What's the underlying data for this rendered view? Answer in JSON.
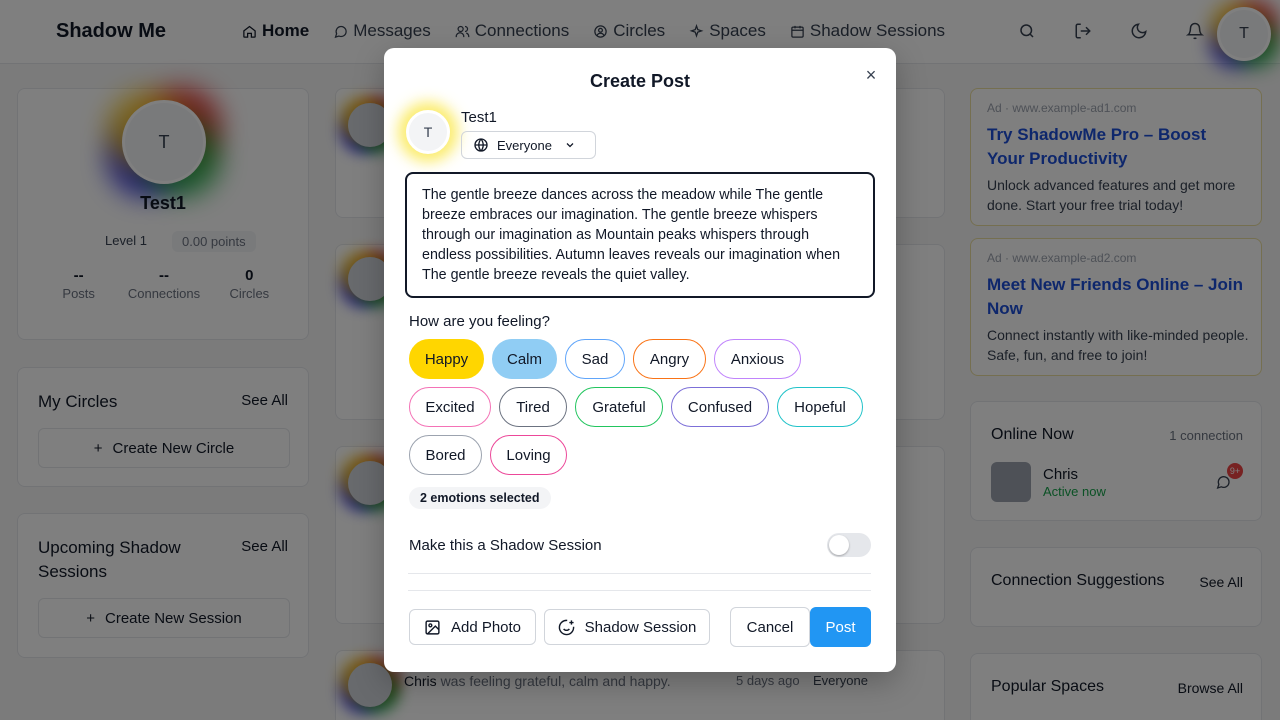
{
  "nav": {
    "brand": "Shadow Me",
    "items": [
      {
        "label": "Home",
        "icon": "home-icon"
      },
      {
        "label": "Messages",
        "icon": "messages-icon"
      },
      {
        "label": "Connections",
        "icon": "users-icon"
      },
      {
        "label": "Circles",
        "icon": "circles-icon"
      },
      {
        "label": "Spaces",
        "icon": "sparkle-icon"
      },
      {
        "label": "Shadow Sessions",
        "icon": "calendar-icon"
      }
    ],
    "avatar_initial": "T"
  },
  "profile": {
    "initial": "T",
    "name": "Test1",
    "level": "Level 1",
    "points": "0.00 points",
    "stats": [
      {
        "value": "--",
        "label": "Posts"
      },
      {
        "value": "--",
        "label": "Connections"
      },
      {
        "value": "0",
        "label": "Circles"
      }
    ]
  },
  "circles": {
    "title": "My Circles",
    "link": "See All",
    "button": "Create New Circle"
  },
  "sessions": {
    "title": "Upcoming Shadow Sessions",
    "link": "See All",
    "button": "Create New Session"
  },
  "feed": {
    "post3": {
      "author": "Chris",
      "action": "was feeling grateful, calm and happy.",
      "time": "5 days ago",
      "audience": "Everyone"
    }
  },
  "ads": [
    {
      "label": "Ad · www.example-ad1.com",
      "title": "Try ShadowMe Pro – Boost Your Productivity",
      "desc": "Unlock advanced features and get more done. Start your free trial today!"
    },
    {
      "label": "Ad · www.example-ad2.com",
      "title": "Meet New Friends Online – Join Now",
      "desc": "Connect instantly with like-minded people. Safe, fun, and free to join!"
    }
  ],
  "online": {
    "title": "Online Now",
    "count": "1 connection",
    "user": "Chris",
    "status": "Active now",
    "badge": "9+"
  },
  "suggestions": {
    "title": "Connection Suggestions",
    "link": "See All"
  },
  "spaces": {
    "title": "Popular Spaces",
    "link": "Browse All"
  },
  "modal": {
    "title": "Create Post",
    "close": "×",
    "initial": "T",
    "user": "Test1",
    "audience": "Everyone",
    "text": "The gentle breeze dances across the meadow while The gentle breeze embraces our imagination. The gentle breeze whispers through our imagination as Mountain peaks whispers through endless possibilities. Autumn leaves reveals our imagination when The gentle breeze reveals the quiet valley.",
    "feeling_label": "How are you feeling?",
    "emotions": [
      {
        "label": "Happy",
        "selected": true,
        "color": "#ffd600"
      },
      {
        "label": "Calm",
        "selected": true,
        "color": "#90cdf4"
      },
      {
        "label": "Sad",
        "selected": false,
        "color": "#60a5fa"
      },
      {
        "label": "Angry",
        "selected": false,
        "color": "#f97316"
      },
      {
        "label": "Anxious",
        "selected": false,
        "color": "#c084fc"
      },
      {
        "label": "Excited",
        "selected": false,
        "color": "#f472b6"
      },
      {
        "label": "Tired",
        "selected": false,
        "color": "#6b7280"
      },
      {
        "label": "Grateful",
        "selected": false,
        "color": "#22c55e"
      },
      {
        "label": "Confused",
        "selected": false,
        "color": "#7c6fd8"
      },
      {
        "label": "Hopeful",
        "selected": false,
        "color": "#22c3c9"
      },
      {
        "label": "Bored",
        "selected": false,
        "color": "#9ca3af"
      },
      {
        "label": "Loving",
        "selected": false,
        "color": "#ec4899"
      }
    ],
    "selected_count": "2 emotions selected",
    "shadow_label": "Make this a Shadow Session",
    "shadow_enabled": false,
    "add_photo": "Add Photo",
    "shadow_session": "Shadow Session",
    "cancel": "Cancel",
    "post": "Post"
  }
}
